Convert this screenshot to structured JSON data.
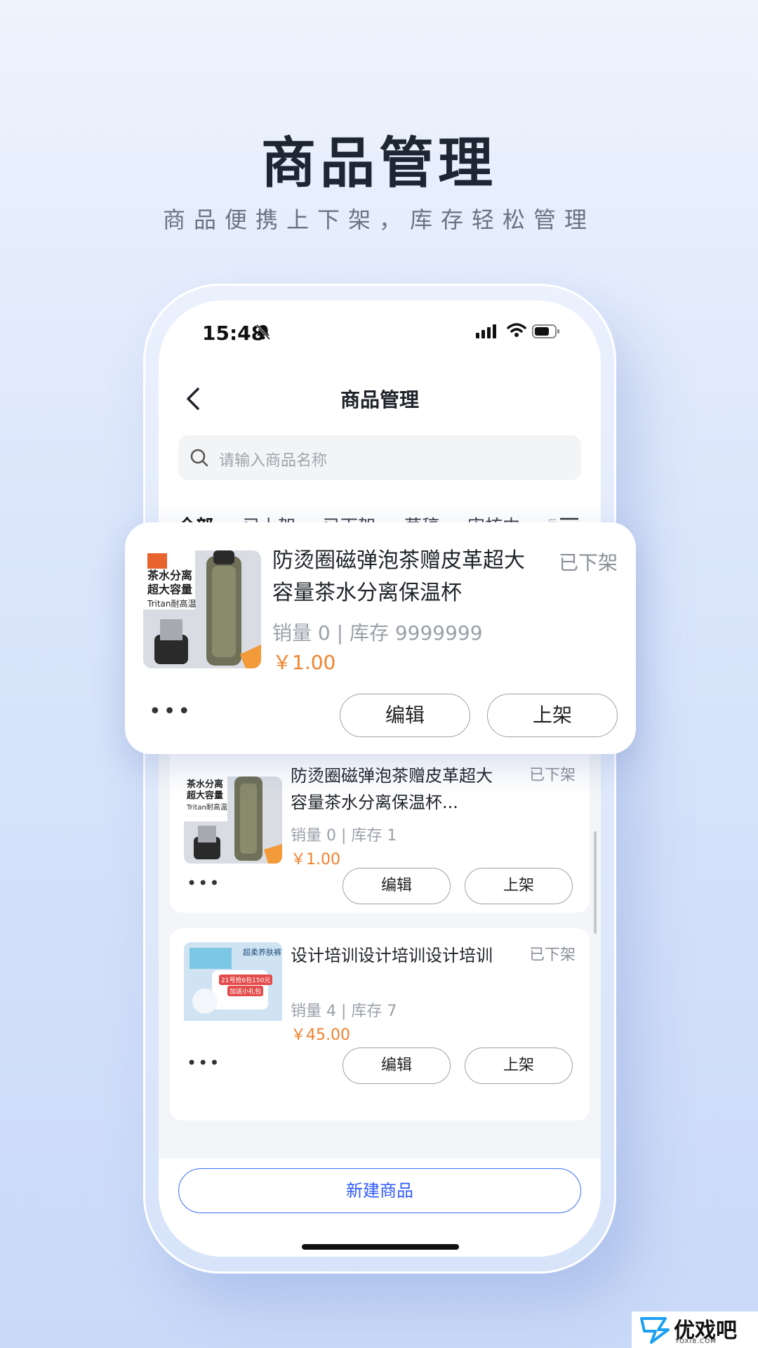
{
  "hero": {
    "title": "商品管理",
    "subtitle": "商品便携上下架，库存轻松管理"
  },
  "status_bar": {
    "time": "15:48"
  },
  "nav": {
    "title": "商品管理"
  },
  "search": {
    "placeholder": "请输入商品名称"
  },
  "tabs": [
    {
      "label": "全部",
      "active": true
    },
    {
      "label": "已上架"
    },
    {
      "label": "已下架"
    },
    {
      "label": "草稿"
    },
    {
      "label": "审核中"
    },
    {
      "label": "官"
    }
  ],
  "products": [
    {
      "title": "防烫圈磁弹泡茶赠皮革超大容量茶水分离保温杯...",
      "status": "已下架",
      "meta": "销量 0 | 库存 1",
      "price": "￥1.00",
      "thumb_lines": [
        "茶水分离",
        "超大容量",
        "Tritan耐高温"
      ],
      "more": "•••",
      "edit": "编辑",
      "publish": "上架"
    },
    {
      "title": "设计培训设计培训设计培训",
      "status": "已下架",
      "meta": "销量 4 | 库存 7",
      "price": "￥45.00",
      "thumb_lines": [
        "超柔养肤裤",
        "21号抢6包150元",
        "加送小礼包"
      ],
      "more": "•••",
      "edit": "编辑",
      "publish": "上架"
    }
  ],
  "featured": {
    "title": "防烫圈磁弹泡茶赠皮革超大容量茶水分离保温杯",
    "status": "已下架",
    "meta": "销量 0 | 库存 9999999",
    "price": "￥1.00",
    "thumb_lines": [
      "茶水分离",
      "超大容量",
      "Tritan耐高温"
    ],
    "more": "•••",
    "edit": "编辑",
    "publish": "上架"
  },
  "bottom": {
    "new_label": "新建商品"
  },
  "watermark": {
    "text": "优戏吧",
    "sub": "YOXI8.COM"
  },
  "colors": {
    "accent": "#2f5bff",
    "price": "#f0822f"
  }
}
